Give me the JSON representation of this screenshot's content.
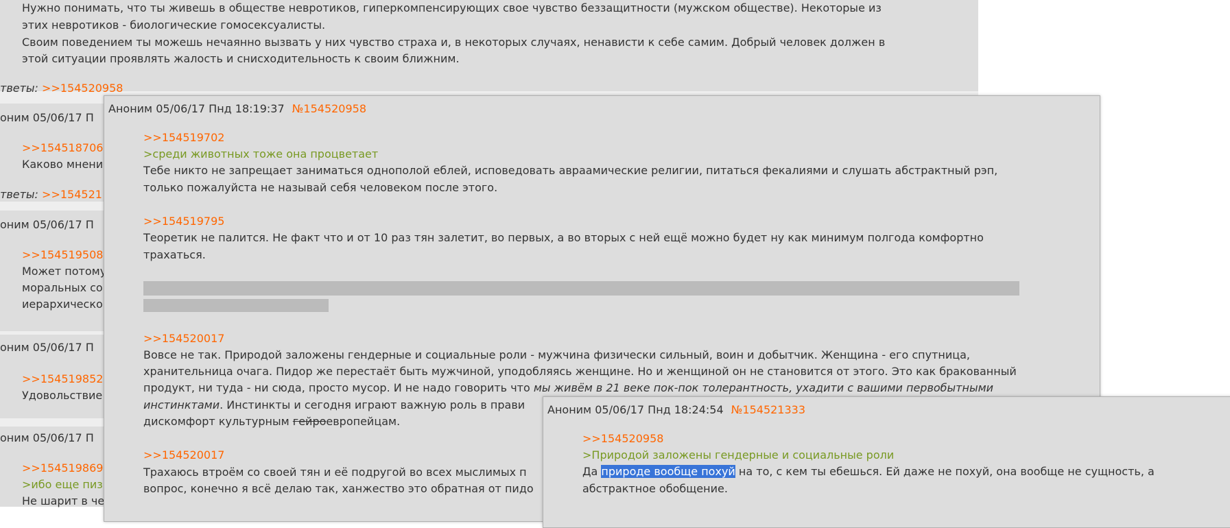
{
  "background_thread": {
    "top_post": {
      "lines": [
        "Нужно понимать, что ты живешь в обществе невротиков, гиперкомпенсирующих свое чувство беззащитности (мужском обществе). Некоторые из",
        "этих невротиков - биологические гомосексуалисты.",
        "Своим поведением ты можешь нечаянно вызвать у них чувство страха и, в некоторых случаях, ненависти к себе самим. Добрый человек должен в",
        "этой ситуации проявлять жалость и снисходительность к своим ближним."
      ],
      "answers_label": "тветы:",
      "answers_link": ">>154520958"
    },
    "posts": [
      {
        "header": "оним 05/06/17 П",
        "reply_link": ">>154518706",
        "lines": [
          "Каково мнени"
        ],
        "answers_label": "тветы:",
        "answers_link": ">>154521"
      },
      {
        "header": "оним 05/06/17 П",
        "reply_link": ">>154519508",
        "lines": [
          "Может потому",
          "моральных со",
          "иерархическо"
        ]
      },
      {
        "header": "оним 05/06/17 П",
        "reply_link": ">>154519852",
        "lines": [
          "Удовольствие"
        ]
      },
      {
        "header": "оним 05/06/17 П",
        "reply_link": ">>154519869",
        "greentext": ">ибо еще пиз",
        "lines": [
          "Не шарит в че"
        ]
      }
    ]
  },
  "popup1": {
    "author": "Аноним",
    "datetime": "05/06/17 Пнд 18:19:37",
    "number": "№154520958",
    "blocks": [
      {
        "link": ">>154519702",
        "greentext": ">среди животных тоже она процветает",
        "lines": [
          "Тебе никто не запрещает заниматься однополой еблей, исповедовать авраамические религии, питаться фекалиями и слушать абстрактный рэп,",
          "только пожалуйста не называй себя человеком после этого."
        ]
      },
      {
        "link": ">>154519795",
        "lines": [
          "Теоретик не палится. Не факт что и от 10 раз тян залетит, во первых, а во вторых с ней ещё можно будет ну как минимум полгода комфортно",
          "трахаться."
        ]
      },
      {
        "link": ">>154520017",
        "line1": "Вовсе не так. Природой заложены гендерные и социальные роли - мужчина физически сильный, воин и добытчик. Женщина - его спутница,",
        "line2": "хранительница очага. Пидор же перестаёт быть мужчиной, уподобляясь женщине. Но и женщиной он не становится от этого. Это как бракованный",
        "line3_plain": "продукт, ни туда - ни сюда, просто мусор. И не надо говорить что ",
        "line3_italic": "мы живём в 21 веке пок-пок толерантность, ухадити с вашими первобытными",
        "line4_italic": "инстинктами",
        "line4_plain": ". Инстинкты и сегодня играют важную роль в прави",
        "line5_plain": "дискомфорт культурным ",
        "line5_strike": "гейро",
        "line5_tail": "европейцам."
      },
      {
        "link": ">>154520017",
        "lines": [
          "Трахаюсь втроём со своей тян и её подругой во всех мыслимых п",
          "вопрос, конечно я всё делаю так, ханжество это обратная от пидо"
        ]
      }
    ]
  },
  "popup2": {
    "author": "Аноним",
    "datetime": "05/06/17 Пнд 18:24:54",
    "number": "№154521333",
    "link": ">>154520958",
    "greentext": ">Природой заложены гендерные и социальные роли",
    "line1_pre": "Да ",
    "line1_highlight": "природе вообще похуй",
    "line1_post": " на то, с кем ты ебешься. Ей даже не похуй, она вообще не сущность, а",
    "line2": "абстрактное обобщение."
  }
}
